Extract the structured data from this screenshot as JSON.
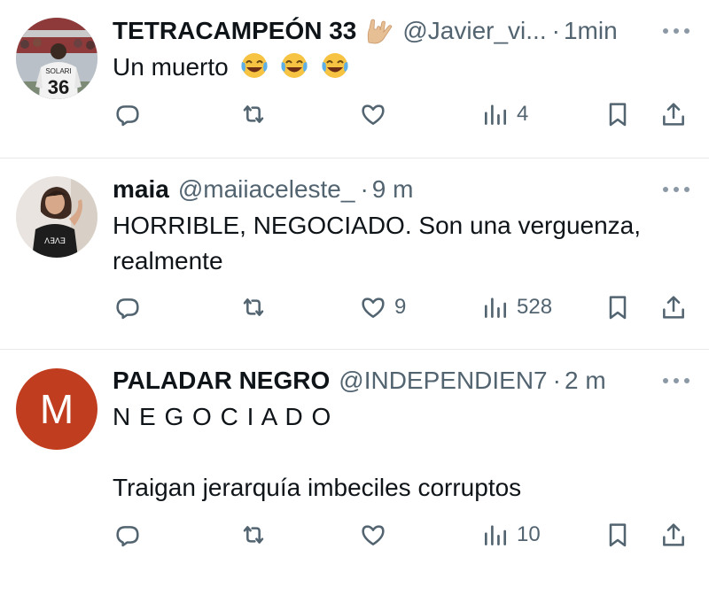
{
  "tweets": [
    {
      "name": "TETRACAMPEÓN 33",
      "handle": "@Javier_vi...",
      "separator": "·",
      "time": "1min",
      "jersey": {
        "name": "SOLARI",
        "number": "36"
      },
      "text_lines": [
        "Un muerto"
      ],
      "emoji": [
        "face-with-tears-of-joy",
        "face-with-tears-of-joy",
        "face-with-tears-of-joy"
      ],
      "counts": {
        "reply": "",
        "retweet": "",
        "like": "",
        "views": "4"
      }
    },
    {
      "name": "maia",
      "handle": "@maiiaceleste_",
      "separator": "·",
      "time": "9 m",
      "text_lines": [
        "HORRIBLE, NEGOCIADO. Son una verguenza,",
        "realmente"
      ],
      "counts": {
        "reply": "",
        "retweet": "",
        "like": "9",
        "views": "528"
      }
    },
    {
      "name": "PALADAR NEGRO",
      "handle": "@INDEPENDIEN7",
      "separator": "·",
      "time": "2 m",
      "avatar_letter": "M",
      "avatar_color": "#c13d1f",
      "text_lines": [
        "N E G O C I A D O",
        "",
        "Traigan jerarquía imbeciles corruptos"
      ],
      "counts": {
        "reply": "",
        "retweet": "",
        "like": "",
        "views": "10"
      }
    }
  ],
  "colors": {
    "text": "#0f1419",
    "muted": "#536471",
    "divider": "#e7e9ea"
  },
  "icons": [
    "reply-icon",
    "retweet-icon",
    "like-icon",
    "views-icon",
    "bookmark-icon",
    "share-icon",
    "more-icon"
  ]
}
